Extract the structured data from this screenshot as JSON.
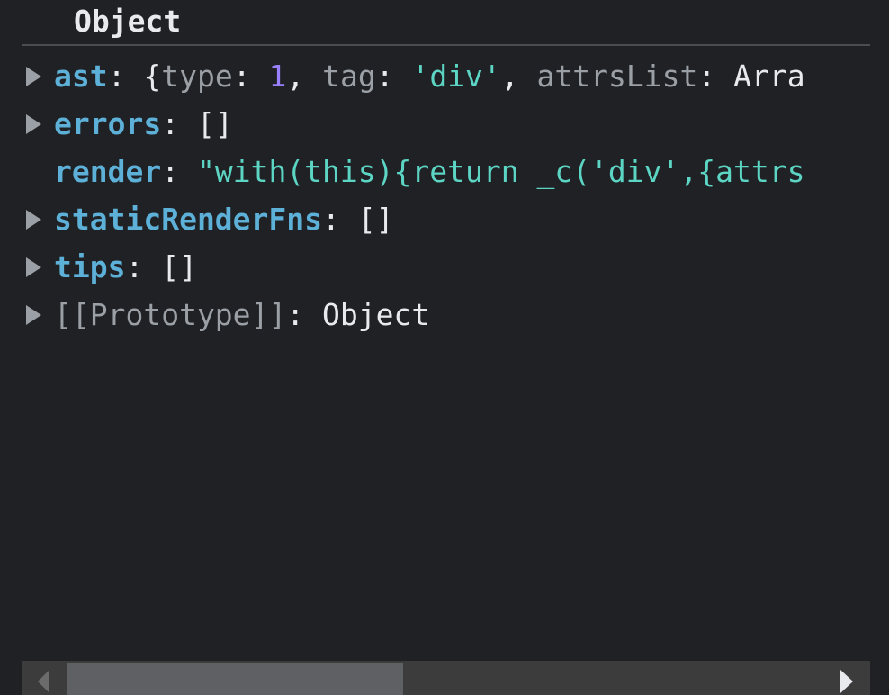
{
  "header": {
    "title": "Object"
  },
  "rows": [
    {
      "expandable": true,
      "key": "ast",
      "sep": ": ",
      "open_brace": "{",
      "type_key": "type",
      "colon1": ": ",
      "type_val": "1",
      "comma1": ", ",
      "tag_key": "tag",
      "colon2": ": ",
      "tag_val": "'div'",
      "comma2": ", ",
      "attrs_key": "attrsList",
      "colon3": ": ",
      "attrs_val": "Arra"
    },
    {
      "expandable": true,
      "key": "errors",
      "sep": ": ",
      "value": "[]"
    },
    {
      "expandable": false,
      "key": "render",
      "sep": ": ",
      "value": "\"with(this){return _c('div',{attrs"
    },
    {
      "expandable": true,
      "key": "staticRenderFns",
      "sep": ": ",
      "value": "[]"
    },
    {
      "expandable": true,
      "key": "tips",
      "sep": ": ",
      "value": "[]"
    },
    {
      "expandable": true,
      "key": "[[Prototype]]",
      "sep": ": ",
      "value": "Object"
    }
  ],
  "icons": {
    "expand": "triangle-right-icon",
    "scroll_left": "scroll-left-arrow-icon",
    "scroll_right": "scroll-right-arrow-icon"
  },
  "colors": {
    "background": "#202124",
    "key": "#5db0d7",
    "string": "#5cd5c4",
    "number": "#9980ff",
    "dim": "#9aa0a6",
    "text": "#e8eaed"
  }
}
